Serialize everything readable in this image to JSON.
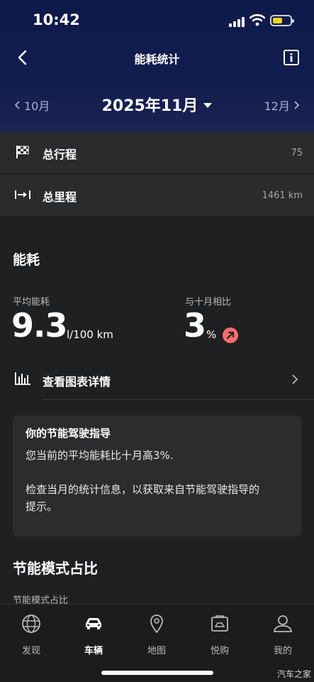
{
  "status_bar": {
    "time": "10:42"
  },
  "nav": {
    "title": "能耗统计"
  },
  "month_selector": {
    "prev": "10月",
    "current": "2025年11月",
    "next": "12月"
  },
  "summary": [
    {
      "label": "总行程",
      "value": "75",
      "icon": "checkered-flag-icon"
    },
    {
      "label": "总里程",
      "value": "1461 km",
      "icon": "distance-arrow-icon"
    }
  ],
  "energy": {
    "title": "能耗",
    "avg_label": "平均能耗",
    "avg_value": "9.3",
    "avg_unit": "l/100 km",
    "compare_label": "与十月相比",
    "compare_value": "3",
    "compare_unit": "%",
    "trend": "up",
    "trend_color": "#ff6b6f"
  },
  "details": {
    "label": "查看图表详情"
  },
  "tip": {
    "title": "你的节能驾驶指导",
    "line1": "您当前的平均能耗比十月高3%.",
    "line2": "检查当月的统计信息，以获取来自节能驾驶指导的",
    "line3": "提示。"
  },
  "mode": {
    "title": "节能模式占比",
    "subtitle": "节能模式占比"
  },
  "tabs": [
    {
      "label": "发现",
      "icon": "globe-icon",
      "active": false
    },
    {
      "label": "车辆",
      "icon": "car-icon",
      "active": true
    },
    {
      "label": "地图",
      "icon": "map-pin-icon",
      "active": false
    },
    {
      "label": "悦购",
      "icon": "shopping-bag-icon",
      "active": false
    },
    {
      "label": "我的",
      "icon": "user-icon",
      "active": false
    }
  ],
  "watermark": "汽车之家",
  "colors": {
    "header_top": "#0d1a4a",
    "background": "#1f2021",
    "accent_badge": "#ff6b6f",
    "battery": "#f5d027"
  }
}
